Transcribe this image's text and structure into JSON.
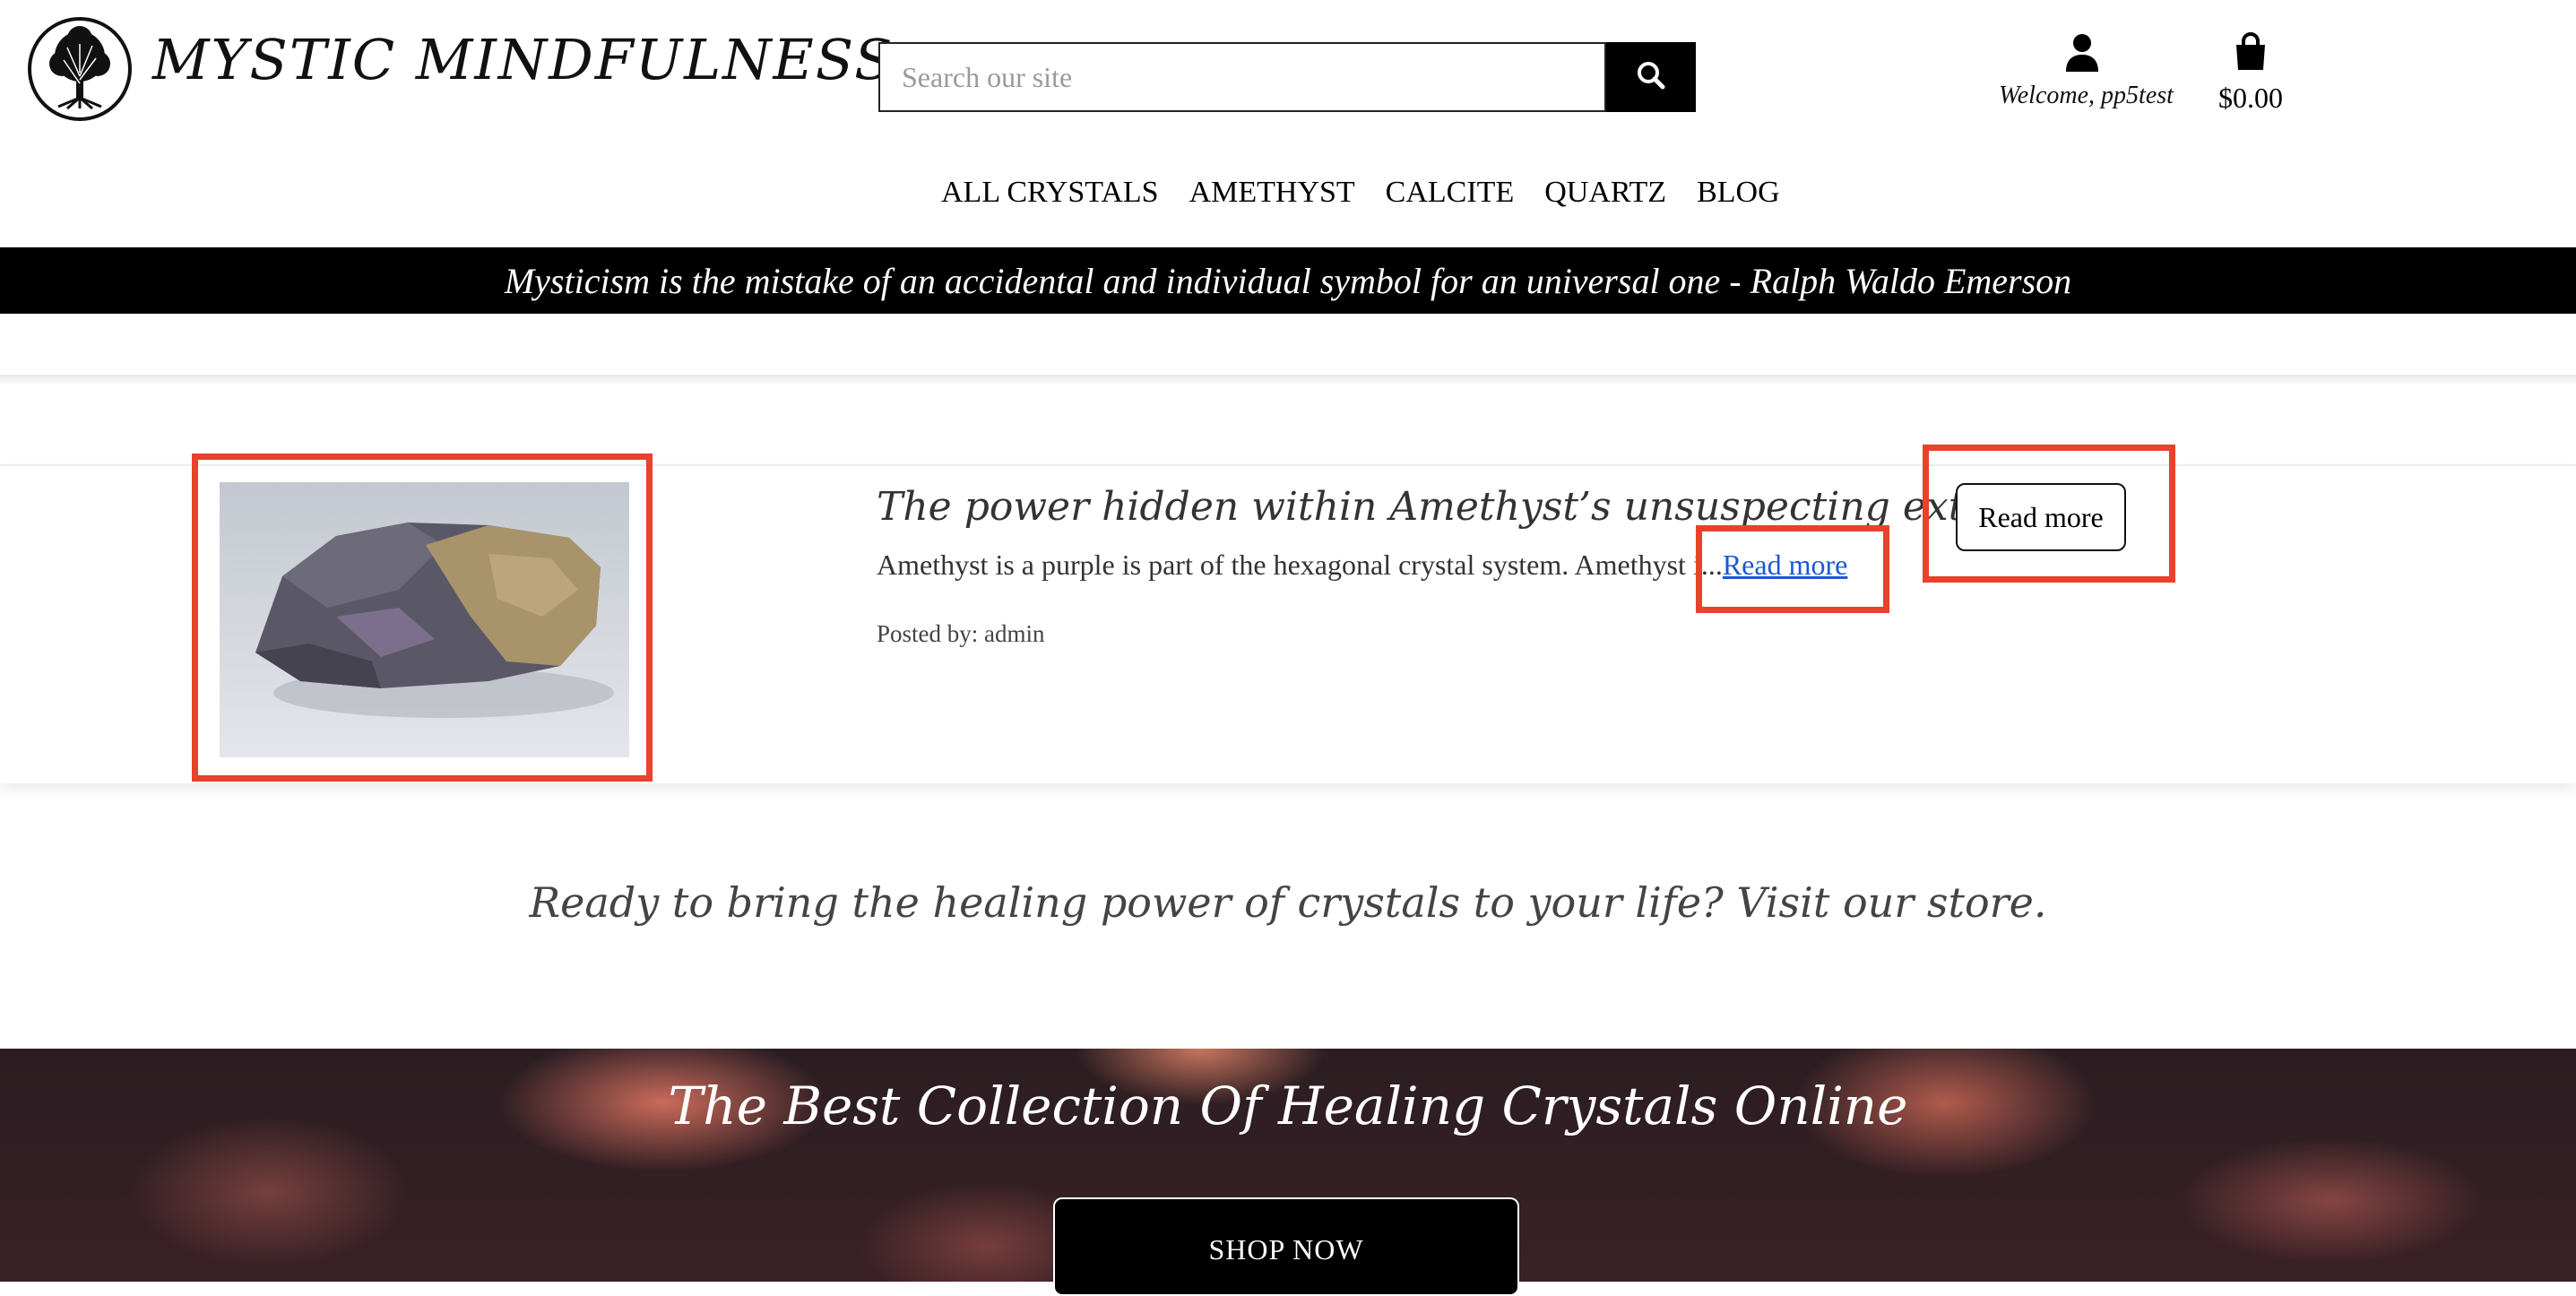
{
  "header": {
    "brand": "MYSTIC MINDFULNESS",
    "search_placeholder": "Search our site",
    "account_label": "Welcome, pp5test",
    "cart_total": "$0.00"
  },
  "nav": {
    "items": [
      "ALL CRYSTALS",
      "AMETHYST",
      "CALCITE",
      "QUARTZ",
      "BLOG"
    ]
  },
  "quote": "Mysticism is the mistake of an accidental and individual symbol for an universal one - Ralph Waldo Emerson",
  "post": {
    "title": "The power hidden within Amethyst’s unsuspecting exterior",
    "excerpt": "Amethyst is a purple is part of the hexagonal crystal system. Amethyst i...",
    "excerpt_link": "Read more",
    "posted_by": "Posted by: admin",
    "button": "Read more"
  },
  "cta": "Ready to bring the healing power of crystals to your life? Visit our store.",
  "hero": {
    "title": "The Best Collection Of Healing Crystals Online",
    "button": "SHOP NOW"
  },
  "colors": {
    "highlight": "#e8412c",
    "link": "#1a57d6",
    "banner": "#000000"
  }
}
